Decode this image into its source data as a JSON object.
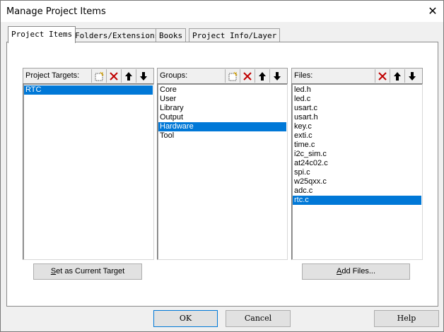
{
  "window": {
    "title": "Manage Project Items",
    "close_glyph": "✕"
  },
  "tabs": [
    {
      "label": "Project Items",
      "active": true
    },
    {
      "label": "Folders/Extensions",
      "active": false
    },
    {
      "label": "Books",
      "active": false
    },
    {
      "label": "Project Info/Layer",
      "active": false
    }
  ],
  "targets": {
    "header": "Project Targets:",
    "items": [
      "RTC"
    ],
    "selected_index": 0,
    "toolbar_icons": [
      "new-icon",
      "delete-icon",
      "move-up-icon",
      "move-down-icon"
    ]
  },
  "groups": {
    "header": "Groups:",
    "items": [
      "Core",
      "User",
      "Library",
      "Output",
      "Hardware",
      "Tool"
    ],
    "selected_index": 4,
    "toolbar_icons": [
      "new-icon",
      "delete-icon",
      "move-up-icon",
      "move-down-icon"
    ]
  },
  "files": {
    "header": "Files:",
    "items": [
      "led.h",
      "led.c",
      "usart.c",
      "usart.h",
      "key.c",
      "exti.c",
      "time.c",
      "i2c_sim.c",
      "at24c02.c",
      "spi.c",
      "w25qxx.c",
      "adc.c",
      "rtc.c"
    ],
    "selected_index": 12,
    "toolbar_icons": [
      "delete-icon",
      "move-up-icon",
      "move-down-icon"
    ]
  },
  "buttons": {
    "set_target_ul": "S",
    "set_target_rest": "et as Current Target",
    "add_files_ul": "A",
    "add_files_rest": "dd Files...",
    "ok": "OK",
    "cancel": "Cancel",
    "help": "Help"
  },
  "colors": {
    "selection": "#0078d7",
    "delete_red": "#c00000",
    "focus_border": "#0078d7"
  }
}
